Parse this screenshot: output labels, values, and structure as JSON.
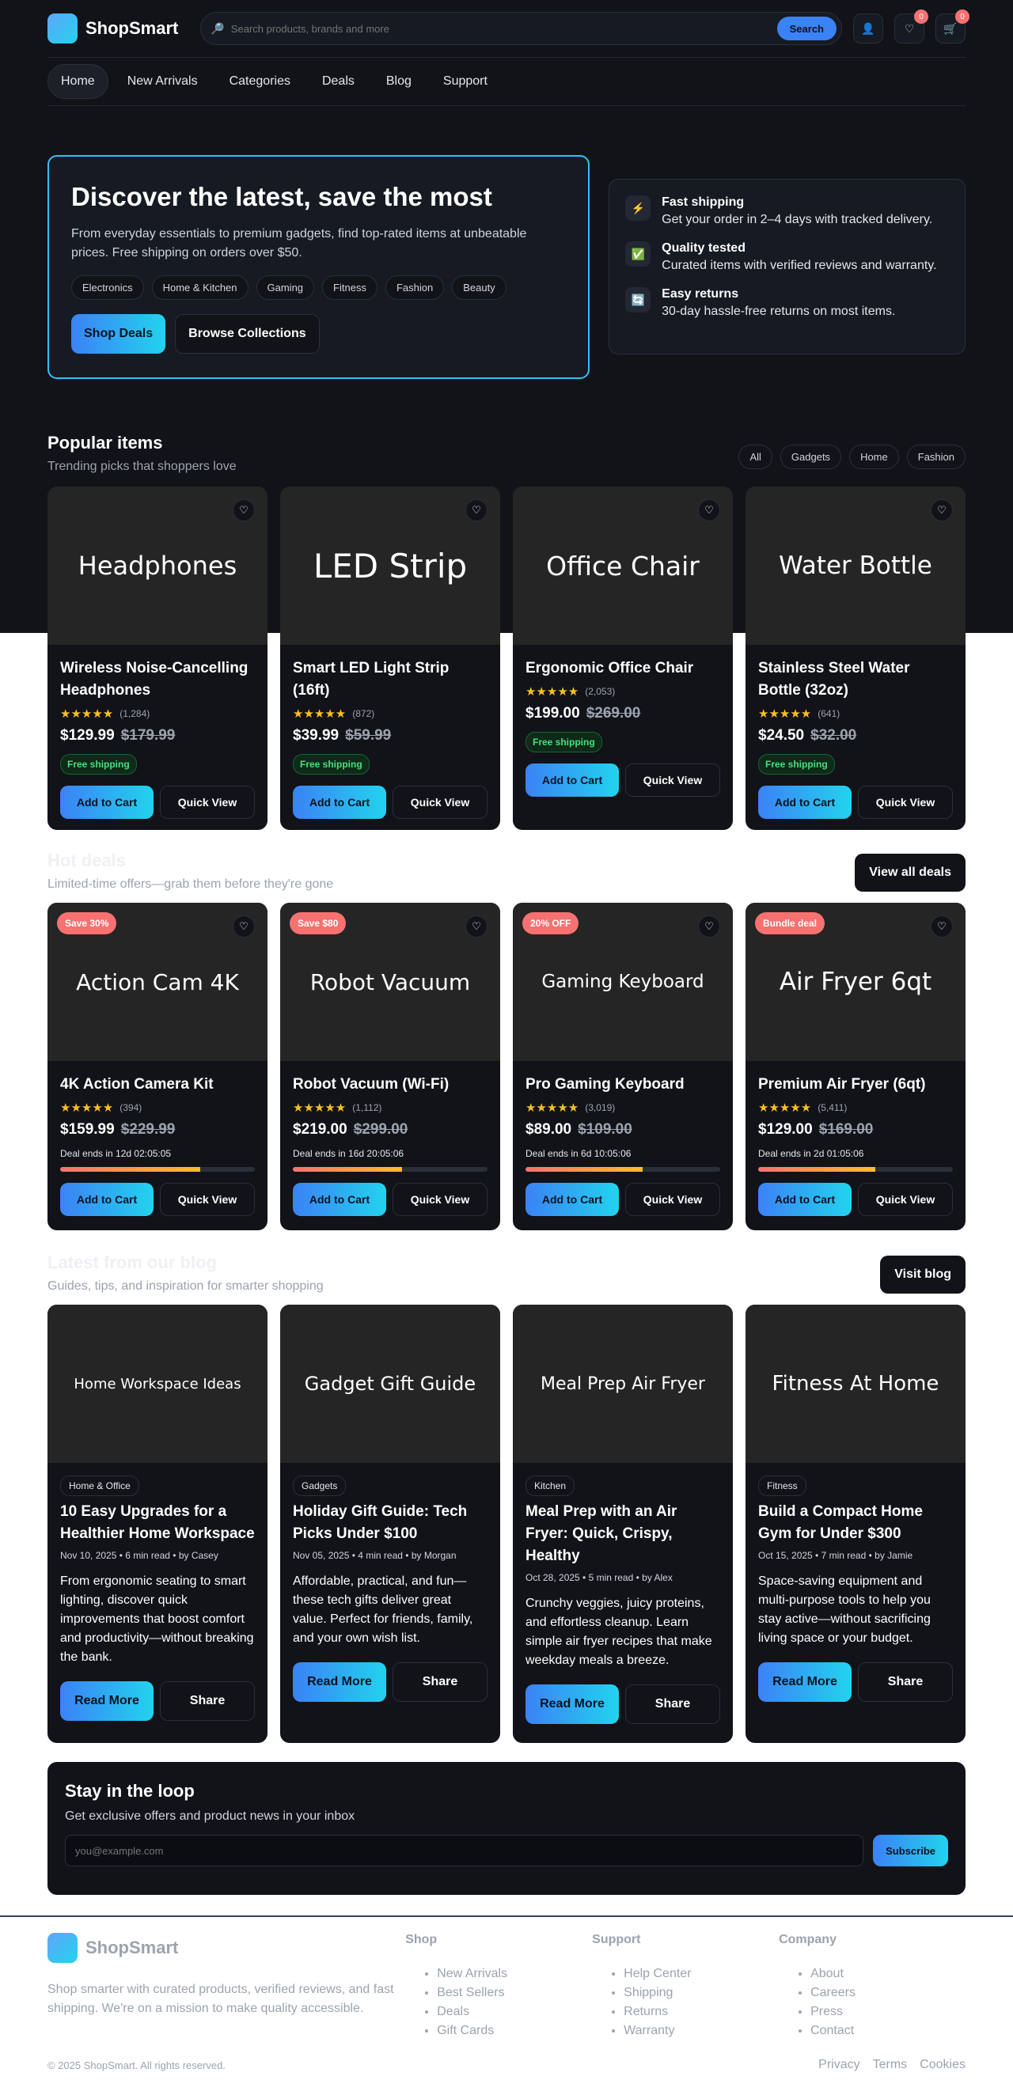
{
  "brand": {
    "name": "ShopSmart"
  },
  "search": {
    "placeholder": "Search products, brands and more",
    "button": "Search"
  },
  "header_icons": [
    {
      "icon": "user-icon"
    },
    {
      "icon": "heart-icon",
      "count": "0"
    },
    {
      "icon": "cart-icon",
      "count": "0"
    }
  ],
  "nav": [
    "Home",
    "New Arrivals",
    "Categories",
    "Deals",
    "Blog",
    "Support"
  ],
  "hero": {
    "title": "Discover the latest, save the most",
    "subtitle": "From everyday essentials to premium gadgets, find top-rated items at unbeatable prices. Free shipping on orders over $50.",
    "chips": [
      "Electronics",
      "Home & Kitchen",
      "Gaming",
      "Fitness",
      "Fashion",
      "Beauty"
    ],
    "primary_button": "Shop Deals",
    "secondary_button": "Browse Collections"
  },
  "features": [
    {
      "icon": "lightning-icon",
      "title": "Fast shipping",
      "desc": "Get your order in 2–4 days with tracked delivery."
    },
    {
      "icon": "check-icon",
      "title": "Quality tested",
      "desc": "Curated items with verified reviews and warranty."
    },
    {
      "icon": "return-icon",
      "title": "Easy returns",
      "desc": "30-day hassle-free returns on most items."
    }
  ],
  "popular": {
    "title": "Popular items",
    "subtitle": "Trending picks that shoppers love",
    "filters": [
      "All",
      "Gadgets",
      "Home",
      "Fashion"
    ],
    "items": [
      {
        "image_text": "Headphones",
        "name": "Wireless Noise-Cancelling Headphones",
        "rating": 5,
        "reviews": "(1,284)",
        "price": "$129.99",
        "old_price": "$179.99",
        "badge": "Free shipping",
        "add": "Add to Cart",
        "quick": "Quick View"
      },
      {
        "image_text": "LED Strip",
        "name": "Smart LED Light Strip (16ft)",
        "rating": 5,
        "reviews": "(872)",
        "price": "$39.99",
        "old_price": "$59.99",
        "badge": "Free shipping",
        "add": "Add to Cart",
        "quick": "Quick View"
      },
      {
        "image_text": "Office Chair",
        "name": "Ergonomic Office Chair",
        "rating": 5,
        "reviews": "(2,053)",
        "price": "$199.00",
        "old_price": "$269.00",
        "badge": "Free shipping",
        "add": "Add to Cart",
        "quick": "Quick View"
      },
      {
        "image_text": "Water Bottle",
        "name": "Stainless Steel Water Bottle (32oz)",
        "rating": 5,
        "reviews": "(641)",
        "price": "$24.50",
        "old_price": "$32.00",
        "badge": "Free shipping",
        "add": "Add to Cart",
        "quick": "Quick View"
      }
    ]
  },
  "deals": {
    "title": "Hot deals",
    "subtitle": "Limited-time offers—grab them before they're gone",
    "button": "View all deals",
    "items": [
      {
        "badge": "Save 30%",
        "image_text": "Action Cam 4K",
        "name": "4K Action Camera Kit",
        "rating": 5,
        "reviews": "(394)",
        "price": "$159.99",
        "old_price": "$229.99",
        "ends": "Deal ends in 12d 02:05:05",
        "progress": 0.72,
        "add": "Add to Cart",
        "quick": "Quick View"
      },
      {
        "badge": "Save $80",
        "image_text": "Robot Vacuum",
        "name": "Robot Vacuum (Wi-Fi)",
        "rating": 5,
        "reviews": "(1,112)",
        "price": "$219.00",
        "old_price": "$299.00",
        "ends": "Deal ends in 16d 20:05:06",
        "progress": 0.56,
        "add": "Add to Cart",
        "quick": "Quick View"
      },
      {
        "badge": "20% OFF",
        "image_text": "Gaming Keyboard",
        "name": "Pro Gaming Keyboard",
        "rating": 5,
        "reviews": "(3,019)",
        "price": "$89.00",
        "old_price": "$109.00",
        "ends": "Deal ends in 6d 10:05:06",
        "progress": 0.6,
        "add": "Add to Cart",
        "quick": "Quick View"
      },
      {
        "badge": "Bundle deal",
        "image_text": "Air Fryer 6qt",
        "name": "Premium Air Fryer (6qt)",
        "rating": 5,
        "reviews": "(5,411)",
        "price": "$129.00",
        "old_price": "$169.00",
        "ends": "Deal ends in 2d 01:05:06",
        "progress": 0.6,
        "add": "Add to Cart",
        "quick": "Quick View"
      }
    ]
  },
  "blog": {
    "title": "Latest from our blog",
    "subtitle": "Guides, tips, and inspiration for smarter shopping",
    "button": "Visit blog",
    "posts": [
      {
        "image_text": "Home Workspace Ideas",
        "tag": "Home & Office",
        "title": "10 Easy Upgrades for a Healthier Home Workspace",
        "meta": "Nov 10, 2025 • 6 min read • by Casey",
        "excerpt": "From ergonomic seating to smart lighting, discover quick improvements that boost comfort and productivity—without breaking the bank.",
        "read": "Read More",
        "share": "Share"
      },
      {
        "image_text": "Gadget Gift Guide",
        "tag": "Gadgets",
        "title": "Holiday Gift Guide: Tech Picks Under $100",
        "meta": "Nov 05, 2025 • 4 min read • by Morgan",
        "excerpt": "Affordable, practical, and fun—these tech gifts deliver great value. Perfect for friends, family, and your own wish list.",
        "read": "Read More",
        "share": "Share"
      },
      {
        "image_text": "Meal Prep Air Fryer",
        "tag": "Kitchen",
        "title": "Meal Prep with an Air Fryer: Quick, Crispy, Healthy",
        "meta": "Oct 28, 2025 • 5 min read • by Alex",
        "excerpt": "Crunchy veggies, juicy proteins, and effortless cleanup. Learn simple air fryer recipes that make weekday meals a breeze.",
        "read": "Read More",
        "share": "Share"
      },
      {
        "image_text": "Fitness At Home",
        "tag": "Fitness",
        "title": "Build a Compact Home Gym for Under $300",
        "meta": "Oct 15, 2025 • 7 min read • by Jamie",
        "excerpt": "Space-saving equipment and multi-purpose tools to help you stay active—without sacrificing living space or your budget.",
        "read": "Read More",
        "share": "Share"
      }
    ]
  },
  "newsletter": {
    "title": "Stay in the loop",
    "subtitle": "Get exclusive offers and product news in your inbox",
    "placeholder": "you@example.com",
    "button": "Subscribe"
  },
  "footer": {
    "brand": "ShopSmart",
    "about": "Shop smarter with curated products, verified reviews, and fast shipping. We're on a mission to make quality accessible.",
    "columns": [
      {
        "title": "Shop",
        "links": [
          "New Arrivals",
          "Best Sellers",
          "Deals",
          "Gift Cards"
        ]
      },
      {
        "title": "Support",
        "links": [
          "Help Center",
          "Shipping",
          "Returns",
          "Warranty"
        ]
      },
      {
        "title": "Company",
        "links": [
          "About",
          "Careers",
          "Press",
          "Contact"
        ]
      }
    ],
    "copyright": "© 2025 ShopSmart. All rights reserved.",
    "legal": [
      "Privacy",
      "Terms",
      "Cookies"
    ]
  },
  "colors": {
    "accent": "#3b82f6",
    "accent2": "#22d3ee",
    "sale": "#f87171",
    "star": "#fbbf24",
    "success": "#4ade80",
    "dark": "#111318"
  }
}
